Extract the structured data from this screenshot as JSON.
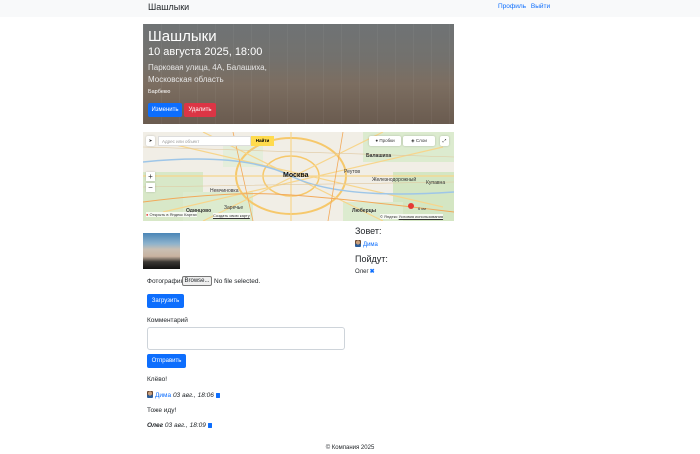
{
  "navbar": {
    "brand": "Шашлыки",
    "profile_link": "Профиль",
    "logout_link": "Выйти"
  },
  "event": {
    "title": "Шашлыки",
    "datetime": "10 августа 2025, 18:00",
    "address": "Парковая улица, 4А, Балашиха, Московская область",
    "tag": "Барбекю",
    "edit_label": "Изменить",
    "delete_label": "Удалить"
  },
  "map": {
    "search_placeholder": "Адрес или объект",
    "search_button": "Найти",
    "traffic_label": "Пробки",
    "layers_label": "Слои",
    "zoom_in": "+",
    "zoom_out": "−",
    "labels": {
      "moscow": "Москва",
      "balashikha": "Балашиха",
      "reutov": "Реутов",
      "zheleznodorozhny": "Железнодорожный",
      "kupavna": "Купавна",
      "lyubertsy": "Люберцы",
      "nemchinovka": "Немчиновка",
      "zarechye": "Заречье",
      "odintsovo": "Одинцово"
    },
    "open_in_yandex": "Открыть в Яндекс Картах",
    "create_map": "Создать свою карту",
    "scale_label": "6 км",
    "copyright": "© Яндекс",
    "terms": "Условия использования"
  },
  "upload": {
    "photo_label": "Фотография",
    "browse_label": "Browse...",
    "file_status": "No file selected.",
    "upload_button": "Загрузить"
  },
  "comment_form": {
    "label": "Комментарий",
    "value": "",
    "send_button": "Отправить"
  },
  "comments": [
    {
      "text": "Клёво!",
      "author": "Дима",
      "date": "03 авг., 18:06"
    },
    {
      "text": "Тоже иду!",
      "author": "Олег",
      "date": "03 авг., 18:09"
    }
  ],
  "sidebar": {
    "host_title": "Зовет:",
    "host_name": "Дима",
    "attendees_title": "Пойдут:",
    "attendees": [
      "Олег"
    ],
    "remove_symbol": "✖"
  },
  "footer": {
    "copyright": "© Компания 2025"
  },
  "colors": {
    "primary": "#0d6efd",
    "danger": "#dc3545",
    "navbar_bg": "#f8f9fa"
  }
}
